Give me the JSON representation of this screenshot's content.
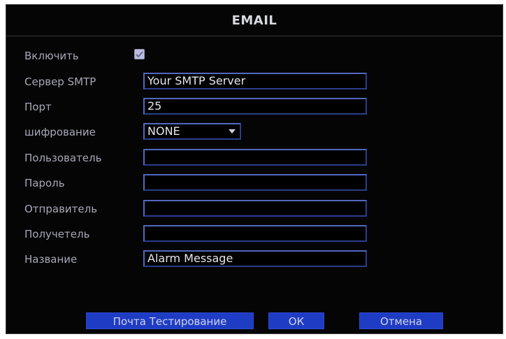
{
  "dialog": {
    "title": "EMAIL"
  },
  "form": {
    "enable": {
      "label": "Включить",
      "checked": true
    },
    "smtp": {
      "label": "Сервер SMTP",
      "value": "Your SMTP Server"
    },
    "port": {
      "label": "Порт",
      "value": "25"
    },
    "encryption": {
      "label": "шифрование",
      "value": "NONE"
    },
    "user": {
      "label": "Пользователь",
      "value": ""
    },
    "password": {
      "label": "Пароль",
      "value": ""
    },
    "sender": {
      "label": "Отправитель",
      "value": ""
    },
    "recipient": {
      "label": "Получетель",
      "value": ""
    },
    "subject": {
      "label": "Название",
      "value": "Alarm Message"
    }
  },
  "buttons": {
    "test": "Почта Тестирование",
    "ok": "ОК",
    "cancel": "Отмена"
  },
  "colors": {
    "background": "#050505",
    "field_border": "#2b3d8a",
    "button": "#1f3cc4",
    "label": "#a8a8b6"
  },
  "icons": {
    "checkbox": "check-icon",
    "dropdown": "chevron-down-icon"
  }
}
